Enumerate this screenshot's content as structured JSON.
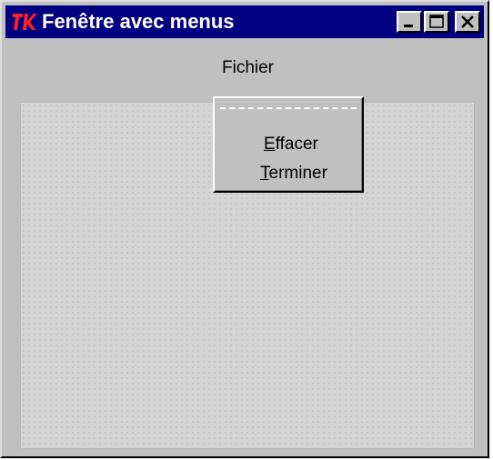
{
  "window": {
    "title": "Fenêtre avec menus",
    "icon": "tk-icon",
    "title_bar_color": "#000080",
    "buttons": [
      "minimize",
      "maximize",
      "close"
    ]
  },
  "menubar": {
    "menus": [
      {
        "label": "Fichier"
      }
    ]
  },
  "dropdown": {
    "tearoff": true,
    "items": [
      {
        "mnemonic": "E",
        "rest": "ffacer",
        "label": "Effacer"
      },
      {
        "mnemonic": "T",
        "rest": "erminer",
        "label": "Terminer"
      }
    ]
  }
}
